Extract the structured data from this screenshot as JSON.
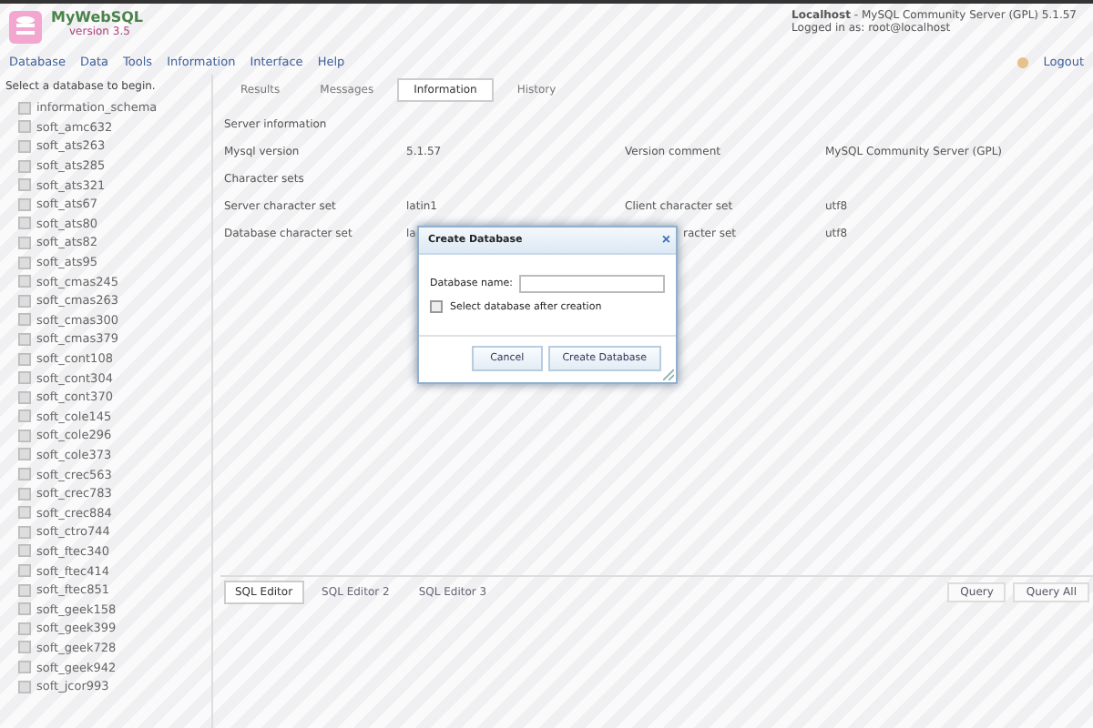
{
  "app": {
    "name": "MyWebSQL",
    "version": "version 3.5"
  },
  "server": {
    "host": "Localhost",
    "info": " - MySQL Community Server (GPL) 5.1.57",
    "login": "Logged in as: root@localhost"
  },
  "menu": [
    "Database",
    "Data",
    "Tools",
    "Information",
    "Interface",
    "Help"
  ],
  "logout": "Logout",
  "sidebar": {
    "title": "Select a database to begin.",
    "items": [
      "information_schema",
      "soft_amc632",
      "soft_ats263",
      "soft_ats285",
      "soft_ats321",
      "soft_ats67",
      "soft_ats80",
      "soft_ats82",
      "soft_ats95",
      "soft_cmas245",
      "soft_cmas263",
      "soft_cmas300",
      "soft_cmas379",
      "soft_cont108",
      "soft_cont304",
      "soft_cont370",
      "soft_cole145",
      "soft_cole296",
      "soft_cole373",
      "soft_crec563",
      "soft_crec783",
      "soft_crec884",
      "soft_ctro744",
      "soft_ftec340",
      "soft_ftec414",
      "soft_ftec851",
      "soft_geek158",
      "soft_geek399",
      "soft_geek728",
      "soft_geek942",
      "soft_jcor993"
    ]
  },
  "tabs": [
    {
      "label": "Results",
      "selected": false
    },
    {
      "label": "Messages",
      "selected": false
    },
    {
      "label": "Information",
      "selected": true
    },
    {
      "label": "History",
      "selected": false
    }
  ],
  "info": [
    {
      "heading": "Server information",
      "rows": [
        [
          "Mysql version",
          "5.1.57",
          "Version comment",
          "MySQL Community Server (GPL)"
        ]
      ]
    },
    {
      "heading": "Character sets",
      "rows": [
        [
          "Server character set",
          "latin1",
          "Client character set",
          "utf8"
        ],
        {
          "cells": [
            "Database character set",
            "la",
            "racter set",
            "utf8"
          ],
          "under_dialog": true
        }
      ]
    }
  ],
  "editor_tabs": [
    {
      "label": "SQL Editor",
      "selected": true
    },
    {
      "label": "SQL Editor 2",
      "selected": false
    },
    {
      "label": "SQL Editor 3",
      "selected": false
    }
  ],
  "query_buttons": [
    "Query",
    "Query All"
  ],
  "dialog": {
    "title": "Create Database",
    "close": "×",
    "name_label": "Database name:",
    "select_after": {
      "label": "Select database after creation",
      "checked": false
    },
    "buttons": [
      "Cancel",
      "Create Database"
    ]
  }
}
